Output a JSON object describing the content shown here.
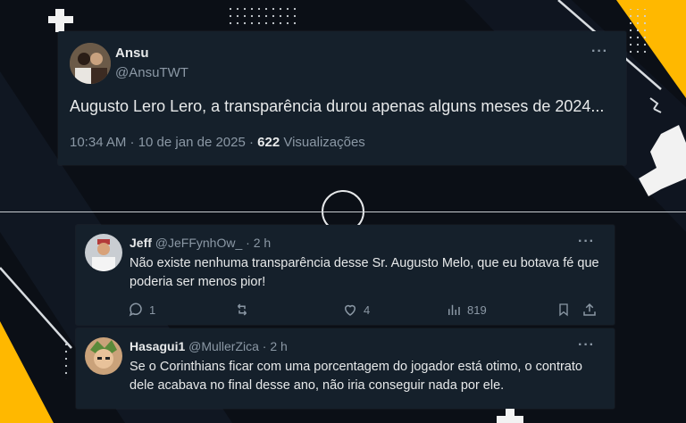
{
  "main_tweet": {
    "name": "Ansu",
    "handle": "@AnsuTWT",
    "text": "Augusto Lero Lero, a transparência durou apenas alguns meses de 2024...",
    "time": "10:34 AM · 10 de jan de 2025 ·",
    "views_count": "622",
    "views_label": "Visualizações",
    "more": "···"
  },
  "replies": [
    {
      "name": "Jeff",
      "handle": "@JeFFynhOw_ · 2 h",
      "text": "Não existe nenhuma transparência desse Sr. Augusto Melo, que eu botava fé que poderia ser menos pior!",
      "replies_count": "1",
      "likes_count": "4",
      "views_count": "819",
      "more": "···"
    },
    {
      "name": "Hasagui1",
      "handle": "@MullerZica · 2 h",
      "text": "Se o Corinthians ficar com uma porcentagem do jogador está otimo, o contrato dele acabava no final desse ano, não iria conseguir nada por ele.",
      "more": "···"
    }
  ],
  "colors": {
    "background": "#0b0f16",
    "card": "#15202b",
    "accent_yellow": "#ffb800",
    "muted_text": "#8b98a5"
  }
}
